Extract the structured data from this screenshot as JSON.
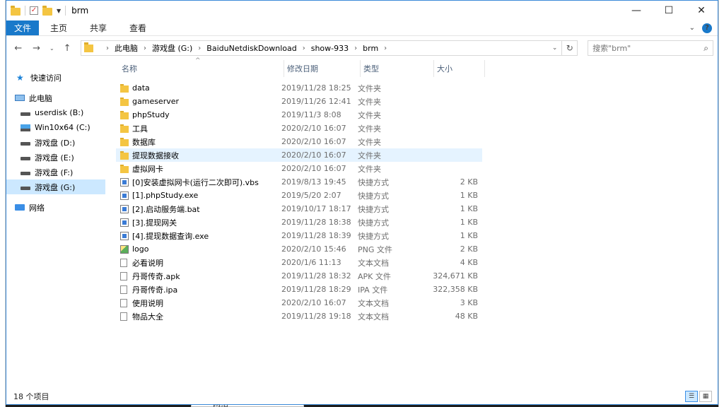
{
  "window": {
    "title": "brm",
    "controls": {
      "minimize": "—",
      "maximize": "☐",
      "close": "✕"
    }
  },
  "ribbon": {
    "tabs": [
      "文件",
      "主页",
      "共享",
      "查看"
    ],
    "expand": "⌄",
    "help": "?"
  },
  "nav": {
    "back": "←",
    "forward": "→",
    "recent": "⌄",
    "up": "↑"
  },
  "address": {
    "crumbs": [
      "此电脑",
      "游戏盘 (G:)",
      "BaiduNetdiskDownload",
      "show-933",
      "brm"
    ],
    "sep": "›"
  },
  "search": {
    "placeholder": "搜索\"brm\""
  },
  "sidebar": {
    "items": [
      {
        "label": "快速访问",
        "icon": "star-icon"
      },
      {
        "label": "此电脑",
        "icon": "computer-icon"
      },
      {
        "label": "userdisk (B:)",
        "icon": "drive-icon"
      },
      {
        "label": "Win10x64 (C:)",
        "icon": "windows-drive-icon"
      },
      {
        "label": "游戏盘 (D:)",
        "icon": "drive-icon"
      },
      {
        "label": "游戏盘 (E:)",
        "icon": "drive-icon"
      },
      {
        "label": "游戏盘 (F:)",
        "icon": "drive-icon"
      },
      {
        "label": "游戏盘 (G:)",
        "icon": "drive-icon"
      },
      {
        "label": "网络",
        "icon": "network-icon"
      }
    ]
  },
  "columns": {
    "name": "名称",
    "date": "修改日期",
    "type": "类型",
    "size": "大小",
    "sort_indicator": "^"
  },
  "files": [
    {
      "name": "data",
      "date": "2019/11/28 18:25",
      "type": "文件夹",
      "size": "",
      "kind": "folder"
    },
    {
      "name": "gameserver",
      "date": "2019/11/26 12:41",
      "type": "文件夹",
      "size": "",
      "kind": "folder"
    },
    {
      "name": "phpStudy",
      "date": "2019/11/3 8:08",
      "type": "文件夹",
      "size": "",
      "kind": "folder"
    },
    {
      "name": "工具",
      "date": "2020/2/10 16:07",
      "type": "文件夹",
      "size": "",
      "kind": "folder"
    },
    {
      "name": "数据库",
      "date": "2020/2/10 16:07",
      "type": "文件夹",
      "size": "",
      "kind": "folder"
    },
    {
      "name": "提现数据接收",
      "date": "2020/2/10 16:07",
      "type": "文件夹",
      "size": "",
      "kind": "folder"
    },
    {
      "name": "虚拟网卡",
      "date": "2020/2/10 16:07",
      "type": "文件夹",
      "size": "",
      "kind": "folder"
    },
    {
      "name": "[0]安装虚拟网卡(运行二次即可).vbs",
      "date": "2019/8/13 19:45",
      "type": "快捷方式",
      "size": "2 KB",
      "kind": "shortcut"
    },
    {
      "name": "[1].phpStudy.exe",
      "date": "2019/5/20 2:07",
      "type": "快捷方式",
      "size": "1 KB",
      "kind": "shortcut"
    },
    {
      "name": "[2].启动服务端.bat",
      "date": "2019/10/17 18:17",
      "type": "快捷方式",
      "size": "1 KB",
      "kind": "shortcut"
    },
    {
      "name": "[3].提现网关",
      "date": "2019/11/28 18:38",
      "type": "快捷方式",
      "size": "1 KB",
      "kind": "shortcut"
    },
    {
      "name": "[4].提现数据查询.exe",
      "date": "2019/11/28 18:39",
      "type": "快捷方式",
      "size": "1 KB",
      "kind": "shortcut"
    },
    {
      "name": "logo",
      "date": "2020/2/10 15:46",
      "type": "PNG 文件",
      "size": "2 KB",
      "kind": "image"
    },
    {
      "name": "必看说明",
      "date": "2020/1/6 11:13",
      "type": "文本文档",
      "size": "4 KB",
      "kind": "file"
    },
    {
      "name": "丹哥传奇.apk",
      "date": "2019/11/28 18:32",
      "type": "APK 文件",
      "size": "324,671 KB",
      "kind": "file"
    },
    {
      "name": "丹哥传奇.ipa",
      "date": "2019/11/28 18:29",
      "type": "IPA 文件",
      "size": "322,358 KB",
      "kind": "file"
    },
    {
      "name": "使用说明",
      "date": "2020/2/10 16:07",
      "type": "文本文档",
      "size": "3 KB",
      "kind": "file"
    },
    {
      "name": "物品大全",
      "date": "2019/11/28 19:18",
      "type": "文本文档",
      "size": "48 KB",
      "kind": "file"
    }
  ],
  "status": {
    "item_count": "18 个项目"
  },
  "background_window": {
    "label": "网络"
  }
}
